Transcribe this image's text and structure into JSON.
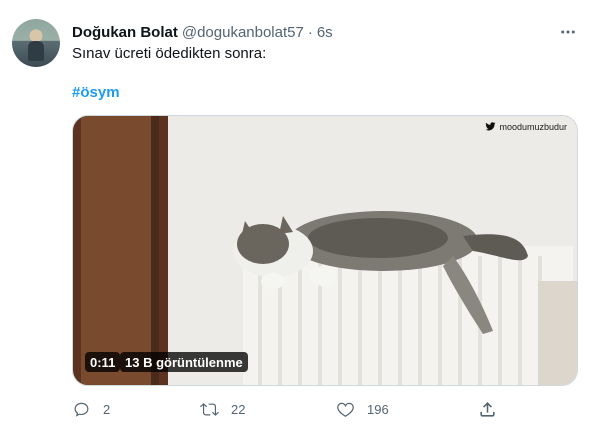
{
  "tweet": {
    "author_name": "Doğukan Bolat",
    "author_handle": "@dogukanbolat57",
    "separator": "·",
    "time": "6s",
    "text": "Sınav ücreti ödedikten sonra:",
    "hashtag": "#ösym",
    "media": {
      "watermark": "moodumuzbudur",
      "duration": "0:11",
      "views": "13 B görüntülenme"
    },
    "actions": {
      "reply_count": "2",
      "retweet_count": "22",
      "like_count": "196"
    }
  },
  "icons": {
    "more": "more-horizontal-icon",
    "reply": "reply-icon",
    "retweet": "retweet-icon",
    "like": "heart-icon",
    "share": "share-icon",
    "watermark_logo": "twitter-bird-icon"
  },
  "colors": {
    "link": "#1d9bf0",
    "secondary_text": "#536471",
    "primary_text": "#0f1419",
    "border": "#cfd9de"
  }
}
